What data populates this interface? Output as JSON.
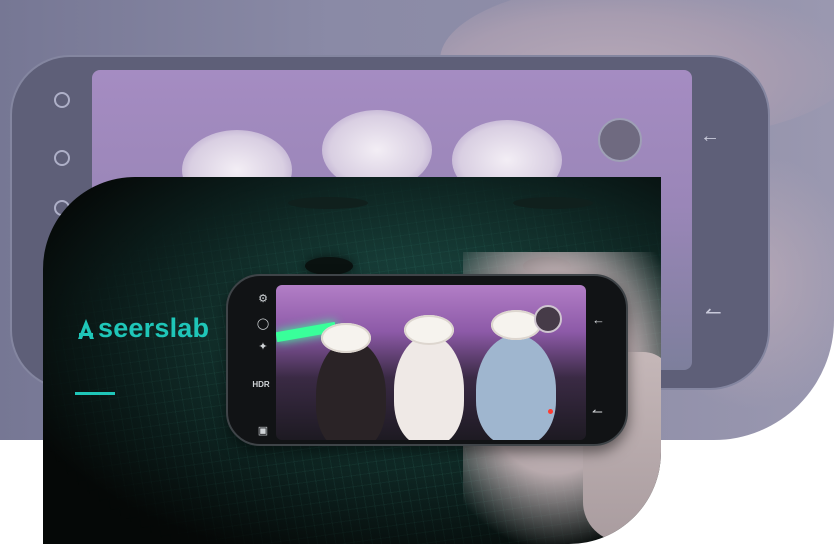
{
  "brand": {
    "name": "seerslab",
    "accent_color": "#1fc6b8"
  },
  "camera_ui": {
    "left_icons": [
      "gear-icon",
      "timer-icon",
      "flash-icon",
      "hdr-icon",
      "camera-switch-icon"
    ],
    "hdr_label": "HDR",
    "right_icons": [
      "back-arrow-icon",
      "shutter-swap-icon"
    ]
  },
  "colors": {
    "background_banner": "#8a8aa6",
    "card_background": "#0b1c1a",
    "screen_tint": "#b27ec6"
  }
}
